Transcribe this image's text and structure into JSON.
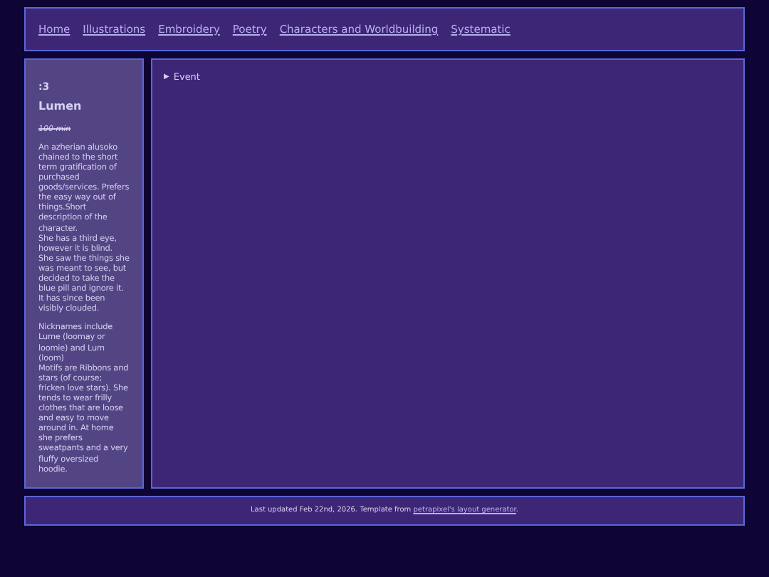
{
  "nav": [
    {
      "label": "Home"
    },
    {
      "label": "Illustrations"
    },
    {
      "label": "Embroidery"
    },
    {
      "label": "Poetry"
    },
    {
      "label": "Characters and Worldbuilding"
    },
    {
      "label": "Systematic"
    }
  ],
  "sidebar": {
    "emoticon": ":3",
    "name": "Lumen",
    "subtitle": "100 min",
    "paragraphs": [
      "An azherian alusoko chained to the short term gratification of purchased goods/services. Prefers the easy way out of things.Short description of the character.\nShe has a third eye, however it is blind. She saw the things she was meant to see, but decided to take the blue pill and ignore it. It has since been visibly clouded.",
      "Nicknames include Lume (loomay or loomie) and Lum (loom)\nMotifs are Ribbons and stars (of course; fricken love stars). She tends to wear frilly clothes that are loose and easy to move around in. At home she prefers sweatpants and a very fluffy oversized hoodie."
    ]
  },
  "main": {
    "disclosure": {
      "marker": "▶",
      "label": "Event",
      "expanded": false
    }
  },
  "footer": {
    "text": "Last updated Feb 22nd, 2026. Template from ",
    "link": "petrapixel's layout generator",
    "end": "."
  }
}
